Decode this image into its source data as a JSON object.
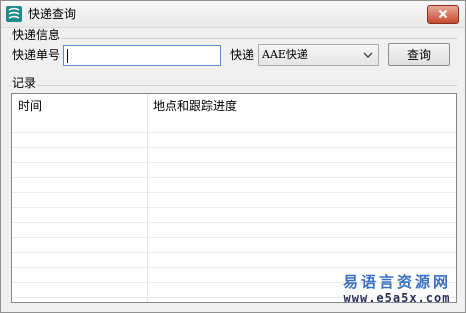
{
  "window": {
    "title": "快递查询",
    "icon": "app-logo-icon",
    "close_icon": "close-icon"
  },
  "group_info": {
    "label": "快递信息",
    "tracking_label": "快递单号",
    "tracking_value": "",
    "courier_label": "快递",
    "courier_selected": "AAE快递",
    "query_button": "查询"
  },
  "group_records": {
    "label": "记录",
    "columns": [
      "时间",
      "地点和跟踪进度"
    ],
    "rows": []
  },
  "watermark": {
    "line1": "易语言资源网",
    "line2": "www.e5a5x.com"
  },
  "colors": {
    "close_button": "#c84a32",
    "input_border": "#5a8fc9",
    "watermark_blue": "#3a6fc4"
  }
}
